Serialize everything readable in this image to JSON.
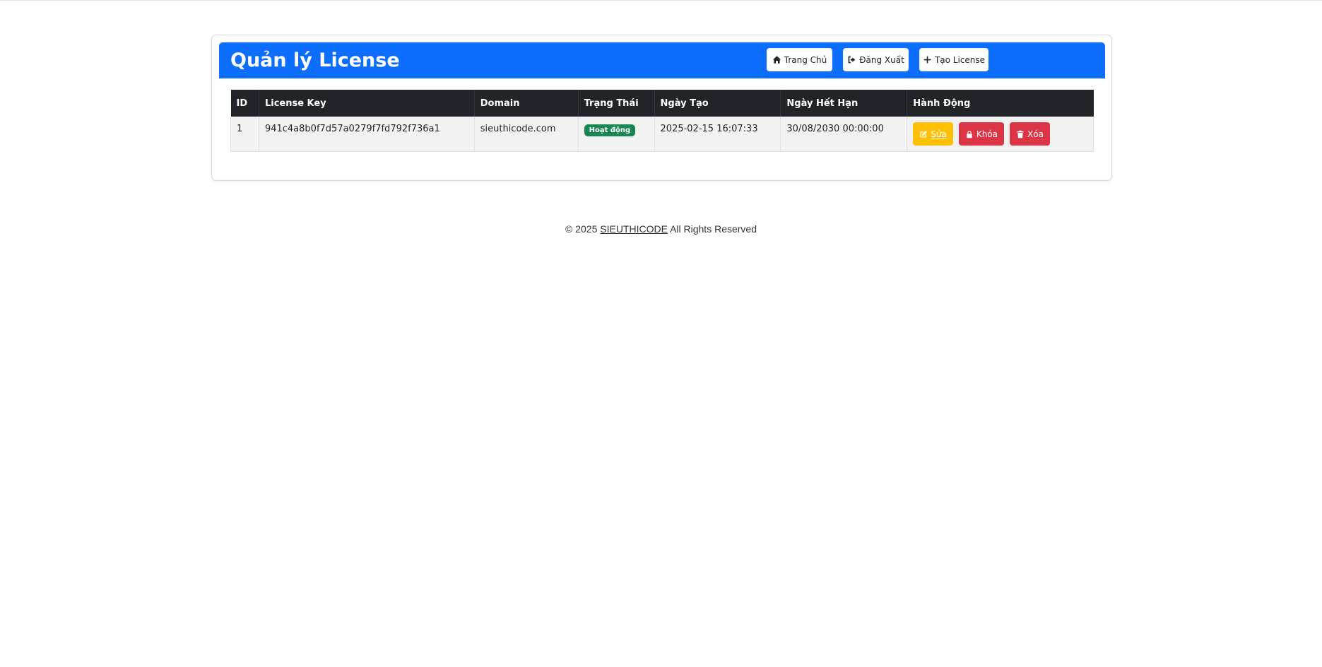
{
  "page": {
    "title": "Quản lý License"
  },
  "header": {
    "buttons": {
      "home_label": "Trang Chủ",
      "logout_label": "Đăng Xuất",
      "create_label": "Tạo License"
    }
  },
  "table": {
    "columns": [
      "ID",
      "License Key",
      "Domain",
      "Trạng Thái",
      "Ngày Tạo",
      "Ngày Hết Hạn",
      "Hành Động"
    ],
    "rows": [
      {
        "id": "1",
        "license_key": "941c4a8b0f7d57a0279f7fd792f736a1",
        "domain": "sieuthicode.com",
        "status": "Hoạt động",
        "created": "2025-02-15 16:07:33",
        "expires": "30/08/2030 00:00:00",
        "actions": {
          "edit_label": "Sửa",
          "lock_label": "Khóa",
          "delete_label": "Xóa"
        }
      }
    ]
  },
  "footer": {
    "prefix": "© 2025",
    "brand": "SIEUTHICODE",
    "suffix": "All Rights Reserved"
  },
  "colors": {
    "primary": "#0d6efd",
    "dark": "#212529",
    "success": "#198754",
    "warning": "#ffc107",
    "danger": "#dc3545"
  },
  "icons": {
    "home": "home-icon",
    "logout": "sign-out-icon",
    "create": "plus-icon",
    "edit": "edit-icon",
    "lock": "lock-icon",
    "delete": "trash-icon"
  }
}
